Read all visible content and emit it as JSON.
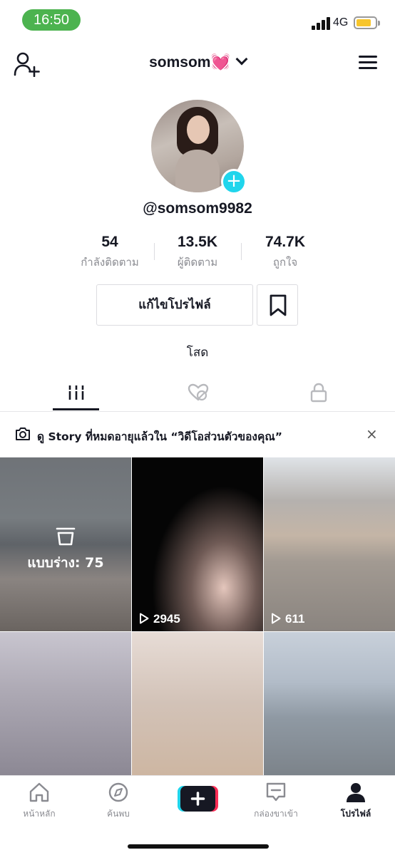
{
  "status_bar": {
    "time": "16:50",
    "network": "4G"
  },
  "header": {
    "username": "somsom",
    "emoji": "💓"
  },
  "profile": {
    "handle": "@somsom9982",
    "bio": "โสด",
    "edit_label": "แก้ไขโปรไฟล์"
  },
  "stats": [
    {
      "value": "54",
      "label": "กำลังติดตาม"
    },
    {
      "value": "13.5K",
      "label": "ผู้ติดตาม"
    },
    {
      "value": "74.7K",
      "label": "ถูกใจ"
    }
  ],
  "tabs": [
    {
      "icon": "grid-icon",
      "active": true
    },
    {
      "icon": "liked-hidden-icon",
      "active": false
    },
    {
      "icon": "lock-icon",
      "active": false
    }
  ],
  "notice": {
    "text": "ดู Story ที่หมดอายุแล้วใน “วิดีโอส่วนตัวของคุณ”",
    "close": "×"
  },
  "videos": [
    {
      "type": "draft",
      "label": "แบบร่าง: 75"
    },
    {
      "type": "video",
      "views": "2945"
    },
    {
      "type": "video",
      "views": "611"
    },
    {
      "type": "video",
      "views": ""
    },
    {
      "type": "video",
      "views": ""
    },
    {
      "type": "video",
      "views": ""
    }
  ],
  "bottom_nav": [
    {
      "label": "หน้าหลัก",
      "icon": "home-icon"
    },
    {
      "label": "ค้นพบ",
      "icon": "compass-icon"
    },
    {
      "label": "",
      "icon": "plus-icon"
    },
    {
      "label": "กล่องขาเข้า",
      "icon": "inbox-icon"
    },
    {
      "label": "โปรไฟล์",
      "icon": "profile-icon"
    }
  ],
  "colors": {
    "accent_cyan": "#20d5ec",
    "accent_red": "#fe2c55",
    "time_pill": "#4cb34f"
  }
}
